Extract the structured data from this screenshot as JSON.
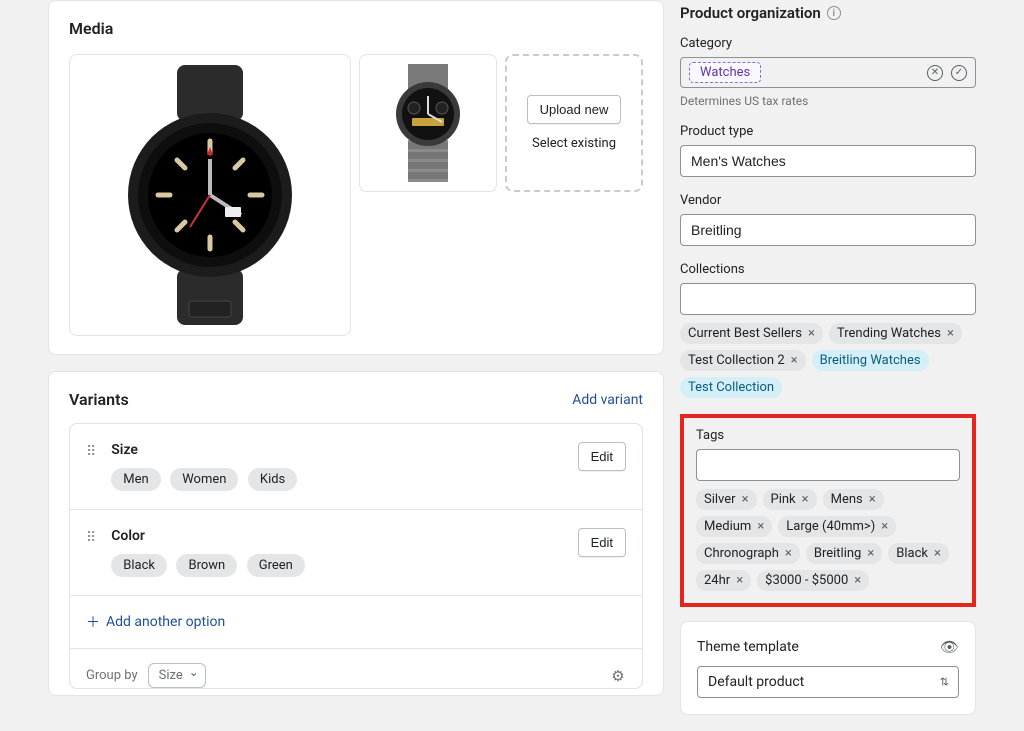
{
  "media": {
    "title": "Media",
    "upload_label": "Upload new",
    "select_label": "Select existing"
  },
  "variants": {
    "title": "Variants",
    "add_variant": "Add variant",
    "add_option": "Add another option",
    "group_by": "Group by",
    "group_by_value": "Size",
    "options": [
      {
        "name": "Size",
        "values": [
          "Men",
          "Women",
          "Kids"
        ],
        "edit": "Edit"
      },
      {
        "name": "Color",
        "values": [
          "Black",
          "Brown",
          "Green"
        ],
        "edit": "Edit"
      }
    ]
  },
  "org": {
    "title": "Product organization",
    "category_label": "Category",
    "category_value": "Watches",
    "category_help": "Determines US tax rates",
    "type_label": "Product type",
    "type_value": "Men's Watches",
    "vendor_label": "Vendor",
    "vendor_value": "Breitling",
    "collections_label": "Collections",
    "collections": [
      {
        "label": "Current Best Sellers",
        "removable": true
      },
      {
        "label": "Trending Watches",
        "removable": true
      },
      {
        "label": "Test Collection 2",
        "removable": true
      },
      {
        "label": "Breitling Watches",
        "removable": false,
        "blue": true
      },
      {
        "label": "Test Collection",
        "removable": false,
        "blue": true
      }
    ],
    "tags_label": "Tags",
    "tags": [
      "Silver",
      "Pink",
      "Mens",
      "Medium",
      "Large (40mm>)",
      "Chronograph",
      "Breitling",
      "Black",
      "24hr",
      "$3000 - $5000"
    ]
  },
  "theme": {
    "title": "Theme template",
    "value": "Default product"
  }
}
